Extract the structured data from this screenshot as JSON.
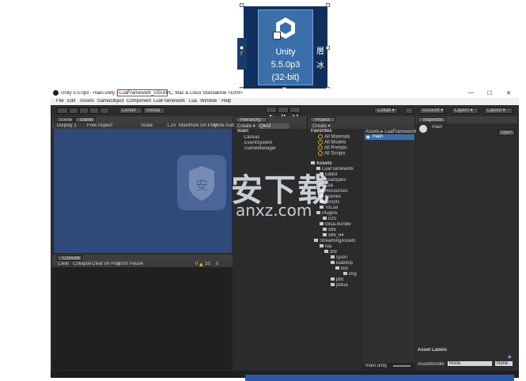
{
  "desktop": {
    "icon_label_line1": "Unity",
    "icon_label_line2": "5.5.0p3",
    "icon_label_line3": "(32-bit)",
    "side_text_left": "r",
    "side_text_right_1": "層",
    "side_text_right_2": "冰"
  },
  "window": {
    "title_prefix": "Unity 5.5.0p3 - main.unity - ",
    "title_highlight": "LuaFramework_UGUI",
    "title_suffix": " - PC, Mac & Linux Standalone <DX9>",
    "controls": [
      "—",
      "☐",
      "✕"
    ]
  },
  "menu": [
    "File",
    "Edit",
    "Assets",
    "GameObject",
    "Component",
    "LuaFramework",
    "Lua",
    "Window",
    "Help"
  ],
  "toolbar": {
    "center_label": "Center",
    "global_label": "Global",
    "collab_label": "Collab ▾",
    "account_label": "Account ▾",
    "layers_label": "Layers ▾",
    "layout_label": "Layout ▾"
  },
  "scene": {
    "tab_scene": "Scene",
    "tab_game": "Game",
    "display": "Display 1",
    "aspect": "Free Aspect",
    "scale": "Scale",
    "scale_value": "1.2x",
    "maximize": "Maximize On Play",
    "mute": "Mute Audio"
  },
  "hierarchy": {
    "tab": "Hierarchy",
    "create": "Create ▾",
    "search": "Q▾All",
    "root": "main",
    "items": [
      "Canvas",
      "EventSystem",
      "GameManager"
    ]
  },
  "project": {
    "tab": "Project",
    "create": "Create ▾",
    "favorites_title": "Favorites",
    "favorites": [
      "All Materials",
      "All Models",
      "All Prefabs",
      "All Scripts"
    ],
    "assets_title": "Assets",
    "tree": [
      "LuaFramework",
      "Editor",
      "Examples",
      "Lua",
      "Resources",
      "Scenes",
      "Scripts",
      "ToLua",
      "Plugins",
      "iOS",
      "tolua.bundle",
      "x86",
      "x86_64",
      "StreamingAssets",
      "lua",
      "3rd",
      "cjson",
      "luabitop",
      "doc",
      "img",
      "pbc",
      "pblua"
    ],
    "breadcrumb": "Assets ▸ LuaFramework",
    "selected_file": "main",
    "bottom_file": "main.unity"
  },
  "inspector": {
    "tab": "Inspector",
    "object_name": "main",
    "open_label": "Open",
    "asset_labels": "Asset Labels",
    "assetbundle_label": "AssetBundle",
    "assetbundle_value": "None",
    "variant_value": "None"
  },
  "console": {
    "tab": "Console",
    "buttons": [
      "Clear",
      "Collapse",
      "Clear on Play",
      "Error Pause"
    ],
    "count_info": "0",
    "count_warn": "10",
    "count_error": "0"
  },
  "watermark": {
    "main_text": "安下载",
    "sub_text": "anxz.com"
  },
  "colors": {
    "scene_blue": "#2f4a78",
    "highlight_red": "#d0312d",
    "selection_blue": "#3d6ea6",
    "folder_yellow": "#e2b00d"
  }
}
